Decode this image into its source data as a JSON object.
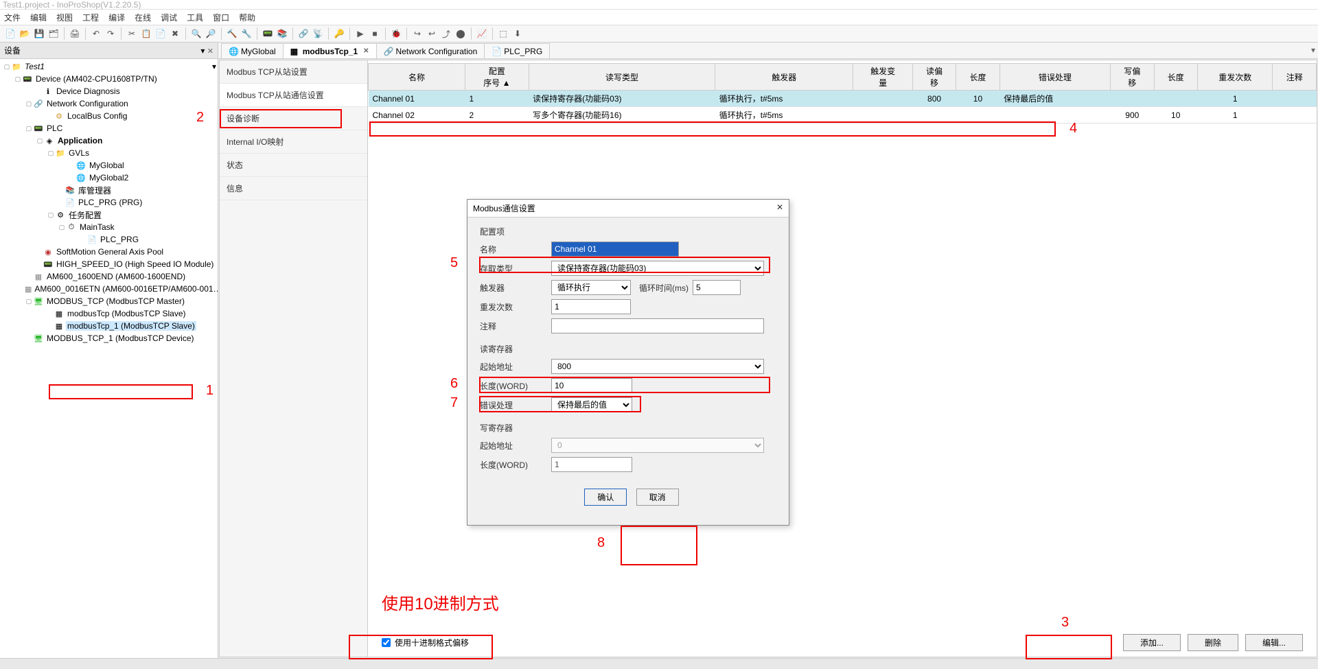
{
  "window": {
    "title": "Test1.project - InoProShop(V1.2.20.5)"
  },
  "menu": {
    "file": "文件",
    "edit": "编辑",
    "view": "视图",
    "project": "工程",
    "compile": "编译",
    "online": "在线",
    "debug": "调试",
    "tools": "工具",
    "window": "窗口",
    "help": "帮助"
  },
  "sidepanel": {
    "title": "设备",
    "close": "✕",
    "dropdown": "▾"
  },
  "tree": {
    "root": "Test1",
    "device": "Device (AM402-CPU1608TP/TN)",
    "diag": "Device Diagnosis",
    "netcfg": "Network Configuration",
    "localbus": "LocalBus Config",
    "plc": "PLC",
    "app": "Application",
    "gvls": "GVLs",
    "myglobal": "MyGlobal",
    "myglobal2": "MyGlobal2",
    "libmgr": "库管理器",
    "plcprg": "PLC_PRG (PRG)",
    "taskcfg": "任务配置",
    "maintask": "MainTask",
    "plcprg2": "PLC_PRG",
    "softmotion": "SoftMotion General Axis Pool",
    "highspeed": "HIGH_SPEED_IO (High Speed IO Module)",
    "am600_1": "AM600_1600END (AM600-1600END)",
    "am600_2": "AM600_0016ETN (AM600-0016ETP/AM600-001…",
    "modbus_tcp": "MODBUS_TCP (ModbusTCP Master)",
    "modbustcp_slave": "modbusTcp (ModbusTCP Slave)",
    "modbustcp_1": "modbusTcp_1 (ModbusTCP Slave)",
    "modbus_tcp_dev": "MODBUS_TCP_1 (ModbusTCP Device)"
  },
  "tabs": {
    "t1": "MyGlobal",
    "t2": "modbusTcp_1",
    "t3": "Network Configuration",
    "t4": "PLC_PRG"
  },
  "subnav": {
    "s1": "Modbus TCP从站设置",
    "s2": "Modbus TCP从站通信设置",
    "s3": "设备诊断",
    "s4": "Internal I/O映射",
    "s5": "状态",
    "s6": "信息"
  },
  "grid": {
    "headers": {
      "name": "名称",
      "cfgno": "配置\n序号",
      "rwtype": "读写类型",
      "trigger": "触发器",
      "trigvar": "触发变\n量",
      "roff": "读偏\n移",
      "len": "长度",
      "err": "错误处理",
      "woff": "写偏\n移",
      "len2": "长度",
      "retry": "重发次数",
      "note": "注释"
    },
    "rows": [
      {
        "name": "Channel 01",
        "cfgno": "1",
        "rwtype": "读保持寄存器(功能码03)",
        "trigger": "循环执行，t#5ms",
        "trigvar": "",
        "roff": "800",
        "len": "10",
        "err": "保持最后的值",
        "woff": "",
        "len2": "",
        "retry": "1",
        "note": ""
      },
      {
        "name": "Channel 02",
        "cfgno": "2",
        "rwtype": "写多个寄存器(功能码16)",
        "trigger": "循环执行，t#5ms",
        "trigvar": "",
        "roff": "",
        "len": "",
        "err": "",
        "woff": "900",
        "len2": "10",
        "retry": "1",
        "note": ""
      }
    ]
  },
  "dialog": {
    "title": "Modbus通信设置",
    "section1": "配置项",
    "section2": "读寄存器",
    "section3": "写寄存器",
    "l_name": "名称",
    "v_name": "Channel 01",
    "l_access": "存取类型",
    "v_access": "读保持寄存器(功能码03)",
    "l_trigger": "触发器",
    "v_trigger": "循环执行",
    "l_cycle": "循环时间(ms)",
    "v_cycle": "5",
    "l_retry": "重发次数",
    "v_retry": "1",
    "l_note": "注释",
    "v_note": "",
    "l_startaddr": "起始地址",
    "v_startaddr": "800",
    "l_len": "长度(WORD)",
    "v_len": "10",
    "l_err": "错误处理",
    "v_err": "保持最后的值",
    "l_wstart": "起始地址",
    "v_wstart": "0",
    "l_wlen": "长度(WORD)",
    "v_wlen": "1",
    "ok": "确认",
    "cancel": "取消"
  },
  "bottom": {
    "decimal": "使用十进制格式偏移",
    "add": "添加...",
    "del": "删除",
    "edit": "编辑..."
  },
  "annot": {
    "n1": "1",
    "n2": "2",
    "n3": "3",
    "n4": "4",
    "n5": "5",
    "n6": "6",
    "n7": "7",
    "n8": "8",
    "tip": "使用10进制方式"
  }
}
